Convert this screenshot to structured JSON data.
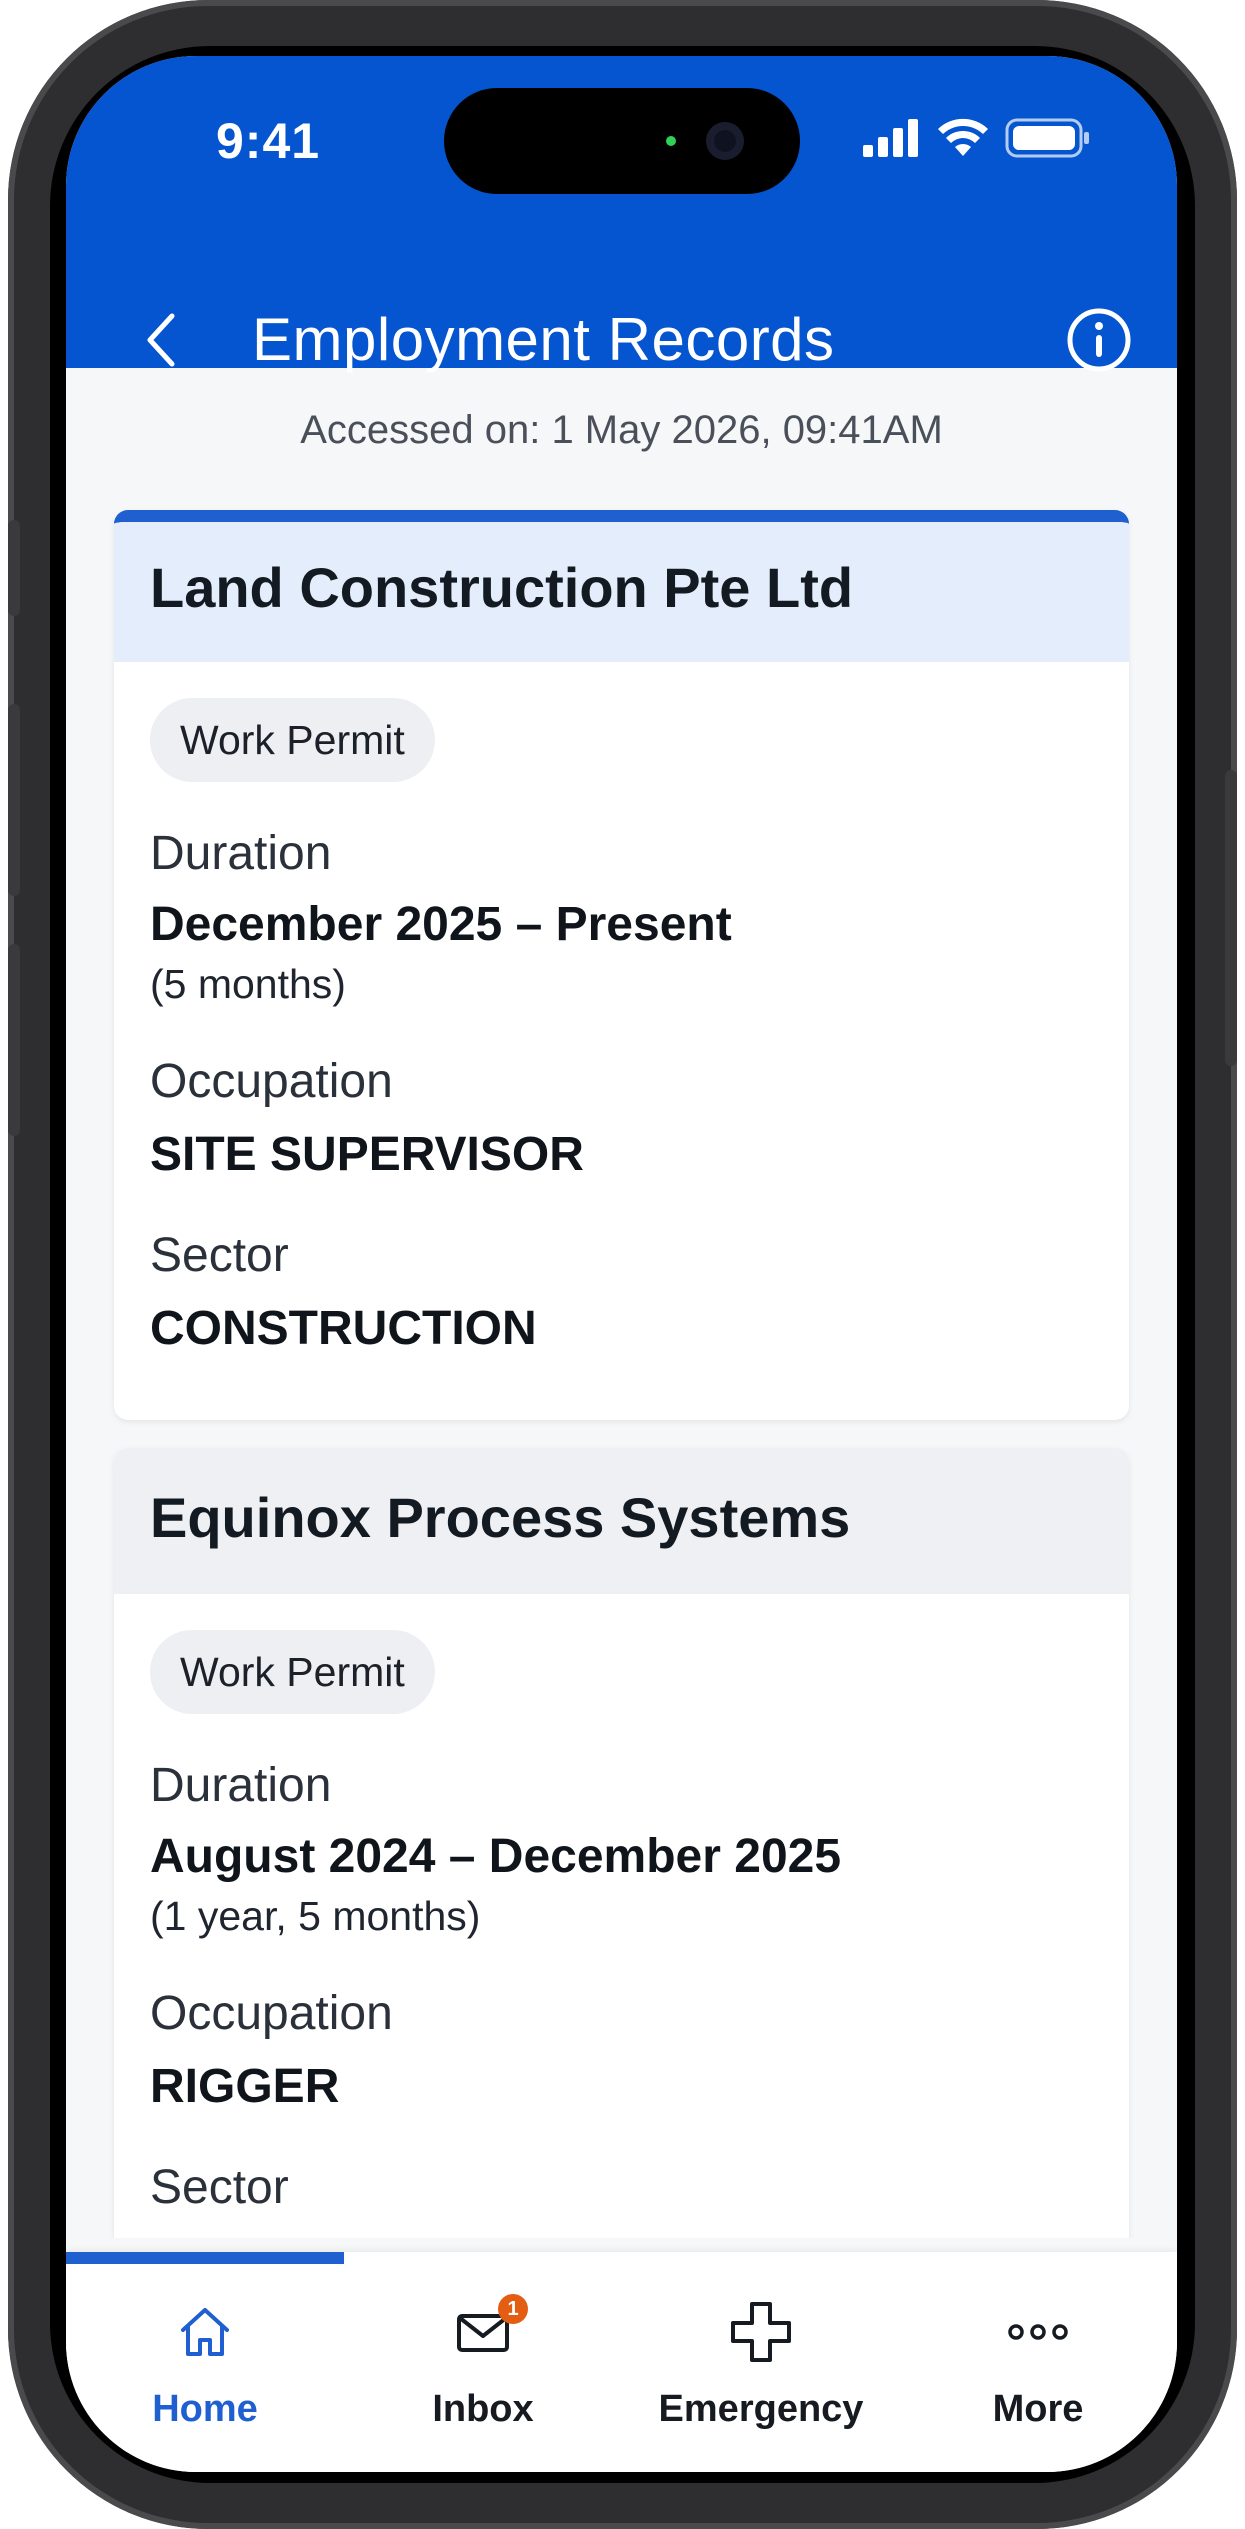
{
  "status_bar": {
    "time": "9:41"
  },
  "header": {
    "title": "Employment Records",
    "background": "#0455cf"
  },
  "accessed_on": "Accessed on: 1 May 2026, 09:41AM",
  "records": [
    {
      "employer": "Land Construction Pte Ltd",
      "pass_type": "Work Permit",
      "duration_label": "Duration",
      "duration": "December 2025 – Present",
      "duration_length": "(5 months)",
      "occupation_label": "Occupation",
      "occupation": "SITE SUPERVISOR",
      "sector_label": "Sector",
      "sector": "CONSTRUCTION"
    },
    {
      "employer": "Equinox Process Systems",
      "pass_type": "Work Permit",
      "duration_label": "Duration",
      "duration": "August 2024 – December 2025",
      "duration_length": "(1 year, 5 months)",
      "occupation_label": "Occupation",
      "occupation": "RIGGER",
      "sector_label": "Sector"
    }
  ],
  "tab_bar": {
    "active": "Home",
    "items": [
      {
        "label": "Home",
        "icon": "home-icon"
      },
      {
        "label": "Inbox",
        "icon": "mail-icon",
        "badge": "1"
      },
      {
        "label": "Emergency",
        "icon": "cross-icon"
      },
      {
        "label": "More",
        "icon": "more-icon"
      }
    ]
  },
  "colors": {
    "accent": "#1f5fd0",
    "badge": "#e35d12"
  }
}
